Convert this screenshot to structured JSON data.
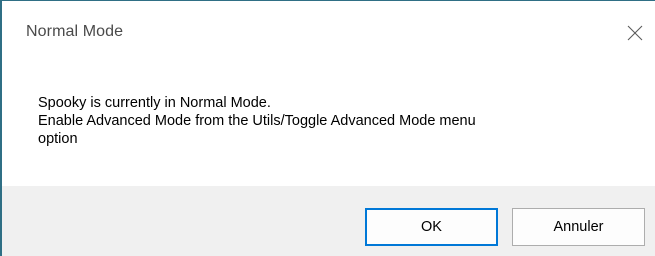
{
  "window": {
    "title": "Normal Mode"
  },
  "message": {
    "line1": "Spooky is currently in Normal Mode.",
    "line2": "Enable Advanced Mode from the Utils/Toggle Advanced Mode menu",
    "line3": "option"
  },
  "buttons": {
    "ok_label": "OK",
    "cancel_label": "Annuler"
  },
  "icons": {
    "close": "close-icon"
  },
  "colors": {
    "accent": "#0078d7",
    "footer_bg": "#f0f0f0",
    "window_border": "#2f6f85"
  }
}
